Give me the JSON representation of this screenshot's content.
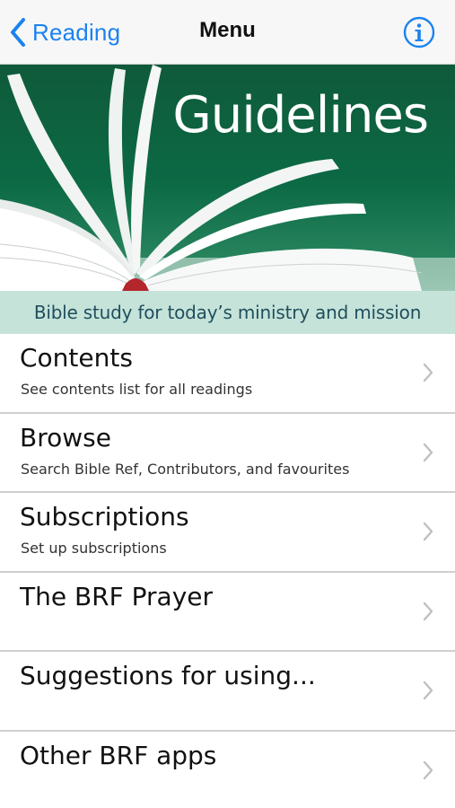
{
  "navbar": {
    "back_label": "Reading",
    "title": "Menu"
  },
  "banner": {
    "title": "Guidelines",
    "tagline": "Bible study for today’s ministry and mission"
  },
  "menu": {
    "items": [
      {
        "title": "Contents",
        "subtitle": "See contents list for all readings"
      },
      {
        "title": "Browse",
        "subtitle": "Search Bible Ref, Contributors, and favourites"
      },
      {
        "title": "Subscriptions",
        "subtitle": "Set up subscriptions"
      },
      {
        "title": "The BRF Prayer",
        "subtitle": ""
      },
      {
        "title": "Suggestions for using...",
        "subtitle": ""
      },
      {
        "title": "Other BRF apps",
        "subtitle": ""
      }
    ]
  },
  "colors": {
    "accent": "#1a82f0",
    "banner_green": "#0c6a45",
    "tagline_bg": "#c6e3da"
  },
  "icons": {
    "back": "chevron-left-icon",
    "info": "info-icon",
    "row": "chevron-right-icon"
  }
}
